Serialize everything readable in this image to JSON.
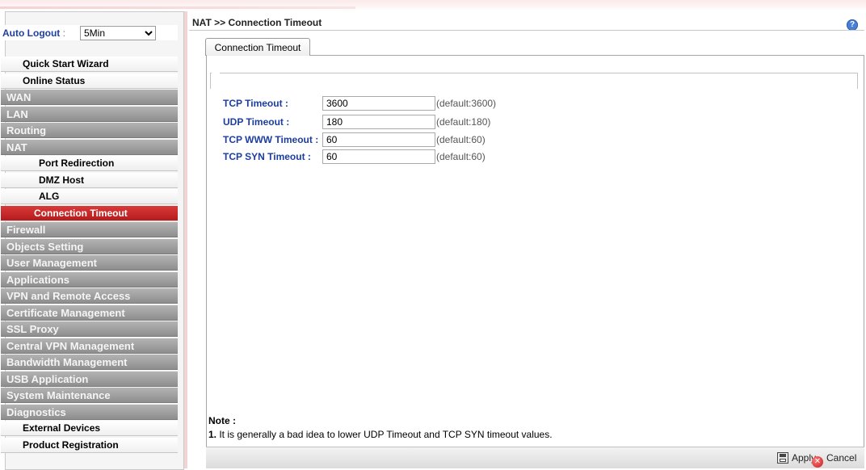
{
  "header": {
    "breadcrumb": "NAT >> Connection Timeout",
    "help_icon": "help-icon"
  },
  "sidebar": {
    "auto_logout": {
      "label": "Auto Logout",
      "separator": " : ",
      "selected": "5Min"
    },
    "items": [
      {
        "label": "Quick Start Wizard",
        "style": "white"
      },
      {
        "label": "Online Status",
        "style": "white"
      },
      {
        "label": "WAN",
        "style": "gray"
      },
      {
        "label": "LAN",
        "style": "gray"
      },
      {
        "label": "Routing",
        "style": "gray"
      },
      {
        "label": "NAT",
        "style": "gray"
      },
      {
        "label": "Port Redirection",
        "style": "sub"
      },
      {
        "label": "DMZ Host",
        "style": "sub"
      },
      {
        "label": "ALG",
        "style": "sub"
      },
      {
        "label": "Connection Timeout",
        "style": "active"
      },
      {
        "label": "Firewall",
        "style": "gray"
      },
      {
        "label": "Objects Setting",
        "style": "gray"
      },
      {
        "label": "User Management",
        "style": "gray"
      },
      {
        "label": "Applications",
        "style": "gray"
      },
      {
        "label": "VPN and Remote Access",
        "style": "gray"
      },
      {
        "label": "Certificate Management",
        "style": "gray"
      },
      {
        "label": "SSL Proxy",
        "style": "gray"
      },
      {
        "label": "Central VPN Management",
        "style": "gray"
      },
      {
        "label": "Bandwidth Management",
        "style": "gray"
      },
      {
        "label": "USB Application",
        "style": "gray"
      },
      {
        "label": "System Maintenance",
        "style": "gray"
      },
      {
        "label": "Diagnostics",
        "style": "gray"
      },
      {
        "label": "External Devices",
        "style": "white"
      },
      {
        "label": "Product Registration",
        "style": "white"
      }
    ]
  },
  "main": {
    "tab_label": "Connection Timeout",
    "fields": [
      {
        "label": "TCP Timeout :",
        "value": "3600",
        "hint": "(default:3600)"
      },
      {
        "label": "UDP Timeout :",
        "value": "180",
        "hint": "(default:180)"
      },
      {
        "label": "TCP WWW Timeout :",
        "value": "60",
        "hint": "(default:60)"
      },
      {
        "label": "TCP SYN Timeout :",
        "value": "60",
        "hint": "(default:60)"
      }
    ],
    "note_title": "Note :",
    "note_number": "1.",
    "note_text": " It is generally a bad idea to lower UDP Timeout and TCP SYN timeout values."
  },
  "footer": {
    "apply_label": "Apply",
    "cancel_label": "Cancel",
    "apply_icon": "save-icon",
    "cancel_icon": "cancel-icon"
  }
}
